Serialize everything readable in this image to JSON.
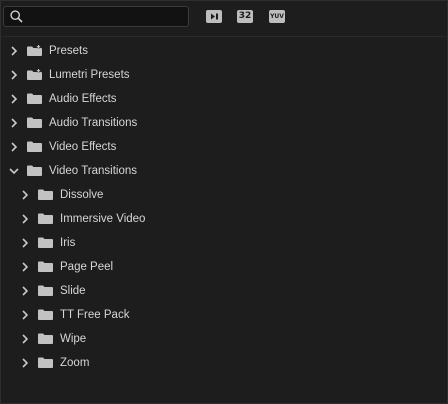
{
  "search": {
    "value": "",
    "placeholder": ""
  },
  "toolbar": {
    "buttons": [
      {
        "name": "accelerated-effects-icon",
        "text": ""
      },
      {
        "name": "32bit-color-icon",
        "text": "32"
      },
      {
        "name": "yuv-effects-icon",
        "text": "YUV"
      }
    ]
  },
  "tree": {
    "items": [
      {
        "label": "Presets",
        "level": 0,
        "expanded": false,
        "icon": "preset-folder-icon"
      },
      {
        "label": "Lumetri Presets",
        "level": 0,
        "expanded": false,
        "icon": "preset-folder-icon"
      },
      {
        "label": "Audio Effects",
        "level": 0,
        "expanded": false,
        "icon": "folder-icon"
      },
      {
        "label": "Audio Transitions",
        "level": 0,
        "expanded": false,
        "icon": "folder-icon"
      },
      {
        "label": "Video Effects",
        "level": 0,
        "expanded": false,
        "icon": "folder-icon"
      },
      {
        "label": "Video Transitions",
        "level": 0,
        "expanded": true,
        "icon": "folder-icon"
      },
      {
        "label": "Dissolve",
        "level": 1,
        "expanded": false,
        "icon": "folder-icon"
      },
      {
        "label": "Immersive Video",
        "level": 1,
        "expanded": false,
        "icon": "folder-icon"
      },
      {
        "label": "Iris",
        "level": 1,
        "expanded": false,
        "icon": "folder-icon"
      },
      {
        "label": "Page Peel",
        "level": 1,
        "expanded": false,
        "icon": "folder-icon"
      },
      {
        "label": "Slide",
        "level": 1,
        "expanded": false,
        "icon": "folder-icon"
      },
      {
        "label": "TT Free Pack",
        "level": 1,
        "expanded": false,
        "icon": "folder-icon"
      },
      {
        "label": "Wipe",
        "level": 1,
        "expanded": false,
        "icon": "folder-icon"
      },
      {
        "label": "Zoom",
        "level": 1,
        "expanded": false,
        "icon": "folder-icon"
      }
    ]
  },
  "colors": {
    "background": "#1d1d1d",
    "text": "#d6d6d6",
    "icon": "#c2c2c2",
    "search_bg": "#121212"
  }
}
